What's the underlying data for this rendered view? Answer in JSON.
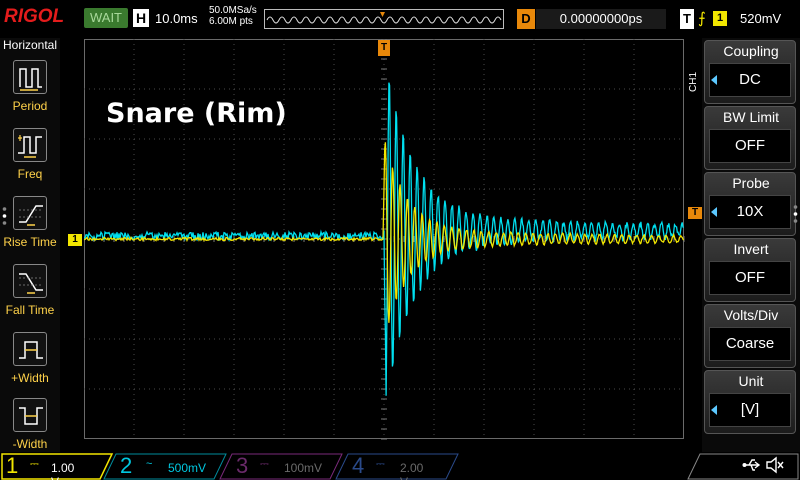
{
  "brand": "RIGOL",
  "status": "WAIT",
  "horizontal": {
    "badge": "H",
    "timebase": "10.0ms",
    "sample_rate": "50.0MSa/s",
    "memory_depth": "6.00M pts"
  },
  "delay": {
    "badge": "D",
    "value": "0.00000000ps"
  },
  "trigger": {
    "badge": "T",
    "edge_symbol": "⨍",
    "source": "1",
    "level": "520mV"
  },
  "left_menu": {
    "title": "Horizontal",
    "items": [
      {
        "label": "Period",
        "icon": "period-icon"
      },
      {
        "label": "Freq",
        "icon": "freq-icon"
      },
      {
        "label": "Rise Time",
        "icon": "rise-time-icon"
      },
      {
        "label": "Fall Time",
        "icon": "fall-time-icon"
      },
      {
        "label": "+Width",
        "icon": "pos-width-icon"
      },
      {
        "label": "-Width",
        "icon": "neg-width-icon"
      }
    ]
  },
  "waveform_title": "Snare (Rim)",
  "markers": {
    "ch1": "1",
    "trigger_level": "T",
    "trigger_pos": "T"
  },
  "right_menu": {
    "channel_tag": "CH1",
    "items": [
      {
        "label": "Coupling",
        "value": "DC",
        "arrow": true
      },
      {
        "label": "BW Limit",
        "value": "OFF",
        "arrow": false
      },
      {
        "label": "Probe",
        "value": "10X",
        "arrow": true
      },
      {
        "label": "Invert",
        "value": "OFF",
        "arrow": false
      },
      {
        "label": "Volts/Div",
        "value": "Coarse",
        "arrow": false
      },
      {
        "label": "Unit",
        "value": "[V]",
        "arrow": true
      }
    ]
  },
  "channels": [
    {
      "num": "1",
      "coupling": "⎓",
      "scale": "1.00 V",
      "color": "#f2e600",
      "active": true
    },
    {
      "num": "2",
      "coupling": "~",
      "scale": "500mV",
      "color": "#00c8e0",
      "active": true
    },
    {
      "num": "3",
      "coupling": "⎓",
      "scale": "100mV",
      "color": "#d040d0",
      "active": false
    },
    {
      "num": "4",
      "coupling": "⎓",
      "scale": "2.00 V",
      "color": "#3a6ad8",
      "active": false
    }
  ],
  "colors": {
    "ch1": "#f2e600",
    "ch2": "#00e0f0",
    "grid": "#4a4a4a",
    "accent": "#e8880a"
  }
}
